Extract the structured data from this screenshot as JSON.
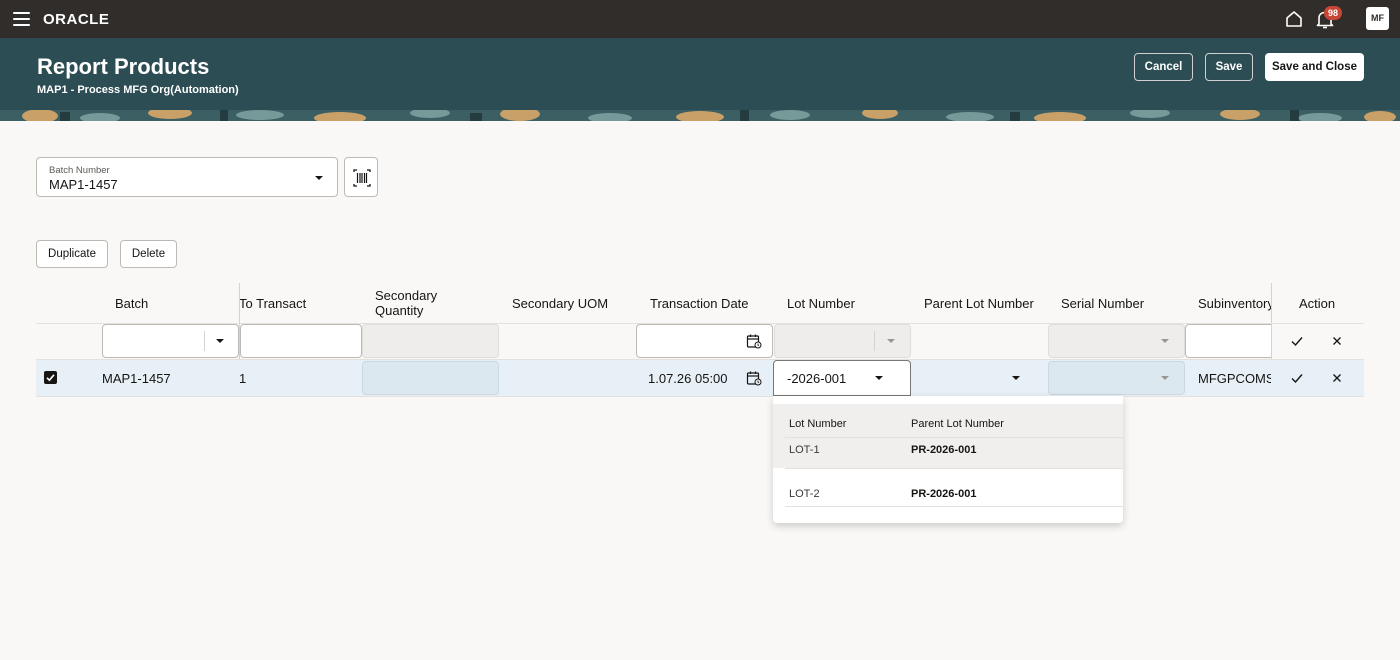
{
  "topbar": {
    "logo": "ORACLE",
    "notifications_count": "98",
    "avatar_initials": "MF",
    "icons": [
      "menu-icon",
      "home-icon",
      "bell-icon"
    ]
  },
  "header": {
    "title": "Report Products",
    "subtitle": "MAP1 - Process MFG Org(Automation)",
    "buttons": {
      "cancel": "Cancel",
      "save": "Save",
      "save_close": "Save and Close"
    }
  },
  "batch_field": {
    "label": "Batch Number",
    "value": "MAP1-1457"
  },
  "toolbar": {
    "duplicate": "Duplicate",
    "delete": "Delete"
  },
  "table": {
    "columns": {
      "batch": "Batch",
      "to_transact": "To Transact",
      "secondary_quantity": "Secondary Quantity",
      "secondary_uom": "Secondary UOM",
      "transaction_date": "Transaction Date",
      "lot_number": "Lot Number",
      "parent_lot_number": "Parent Lot Number",
      "serial_number": "Serial Number",
      "subinventory": "Subinventory",
      "action": "Action"
    },
    "row": {
      "selected": true,
      "batch": "MAP1-1457",
      "to_transact": "1",
      "transaction_date": "1.07.26 05:00",
      "lot_number": "-2026-001",
      "subinventory": "MFGPCOMSU"
    }
  },
  "lot_dropdown": {
    "headers": {
      "lot": "Lot Number",
      "parent": "Parent Lot Number"
    },
    "options": [
      {
        "lot": "LOT-1",
        "parent": "PR-2026-001"
      },
      {
        "lot": "LOT-2",
        "parent": "PR-2026-001"
      }
    ]
  },
  "colors": {
    "topbar": "#312d2a",
    "banner": "#2c4d54",
    "selected_row": "#e6f0f6",
    "badge": "#c74634"
  }
}
